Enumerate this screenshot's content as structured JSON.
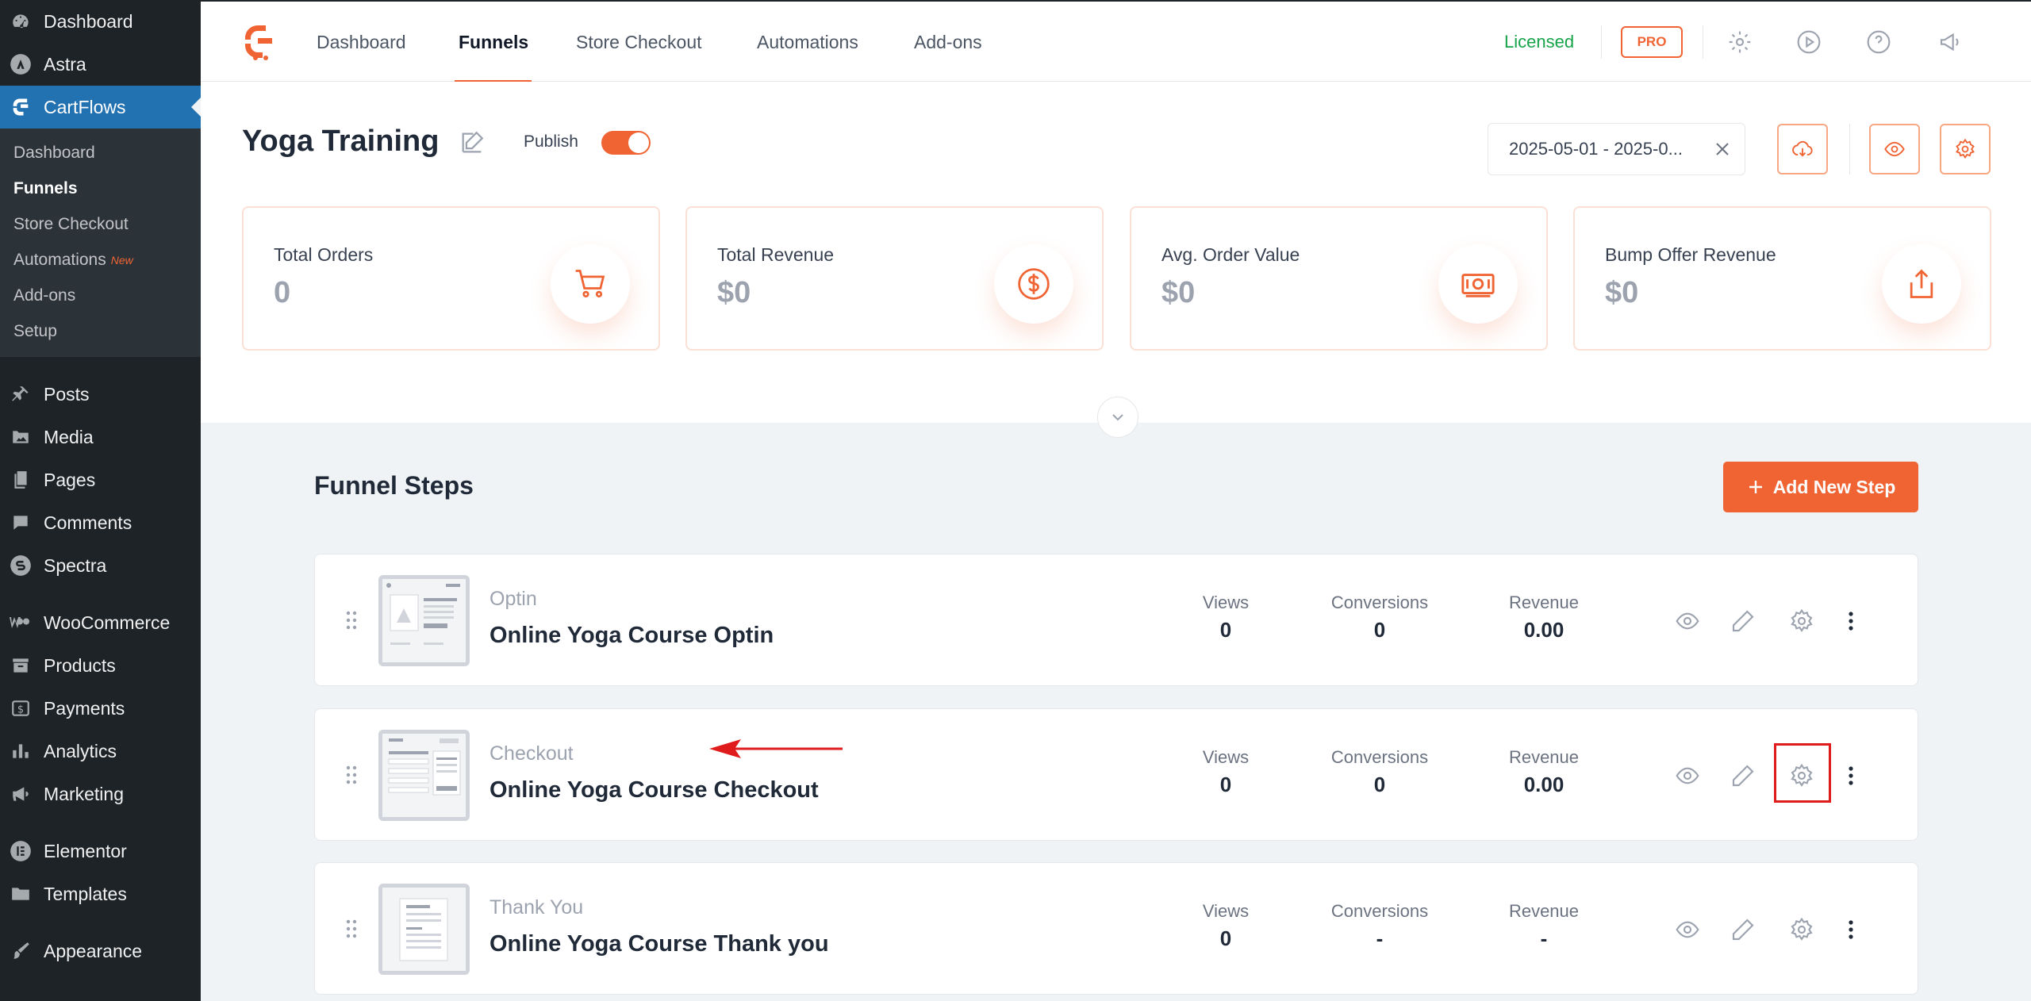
{
  "wp_menu": {
    "dashboard": "Dashboard",
    "astra": "Astra",
    "cartflows": "CartFlows",
    "cartflows_sub": [
      {
        "label": "Dashboard",
        "badge": ""
      },
      {
        "label": "Funnels",
        "badge": ""
      },
      {
        "label": "Store Checkout",
        "badge": ""
      },
      {
        "label": "Automations",
        "badge": "New"
      },
      {
        "label": "Add-ons",
        "badge": ""
      },
      {
        "label": "Setup",
        "badge": ""
      }
    ],
    "posts": "Posts",
    "media": "Media",
    "pages": "Pages",
    "comments": "Comments",
    "spectra": "Spectra",
    "woocommerce": "WooCommerce",
    "products": "Products",
    "payments": "Payments",
    "analytics": "Analytics",
    "marketing": "Marketing",
    "elementor": "Elementor",
    "templates": "Templates",
    "appearance": "Appearance"
  },
  "topnav": {
    "tabs": [
      "Dashboard",
      "Funnels",
      "Store Checkout",
      "Automations",
      "Add-ons"
    ],
    "active_tab": "Funnels",
    "licensed": "Licensed",
    "pro": "PRO"
  },
  "header": {
    "title": "Yoga Training",
    "publish_label": "Publish",
    "publish_on": true,
    "date_range": "2025-05-01 - 2025-0..."
  },
  "stats": [
    {
      "label": "Total Orders",
      "value": "0",
      "icon": "cart-icon"
    },
    {
      "label": "Total Revenue",
      "value": "$0",
      "icon": "dollar-icon"
    },
    {
      "label": "Avg. Order Value",
      "value": "$0",
      "icon": "cash-icon"
    },
    {
      "label": "Bump Offer Revenue",
      "value": "$0",
      "icon": "share-icon"
    }
  ],
  "steps_section": {
    "title": "Funnel Steps",
    "add_button": "Add New Step"
  },
  "metric_labels": {
    "views": "Views",
    "conversions": "Conversions",
    "revenue": "Revenue"
  },
  "steps": [
    {
      "type": "Optin",
      "name": "Online Yoga Course Optin",
      "views": "0",
      "conversions": "0",
      "revenue": "0.00"
    },
    {
      "type": "Checkout",
      "name": "Online Yoga Course Checkout",
      "views": "0",
      "conversions": "0",
      "revenue": "0.00"
    },
    {
      "type": "Thank You",
      "name": "Online Yoga Course Thank you",
      "views": "0",
      "conversions": "-",
      "revenue": "-"
    }
  ],
  "colors": {
    "accent": "#f06434",
    "wp_sidebar": "#1d2327",
    "wp_active": "#2271b1",
    "licensed": "#16a34a",
    "annotation": "#e01b1b"
  }
}
